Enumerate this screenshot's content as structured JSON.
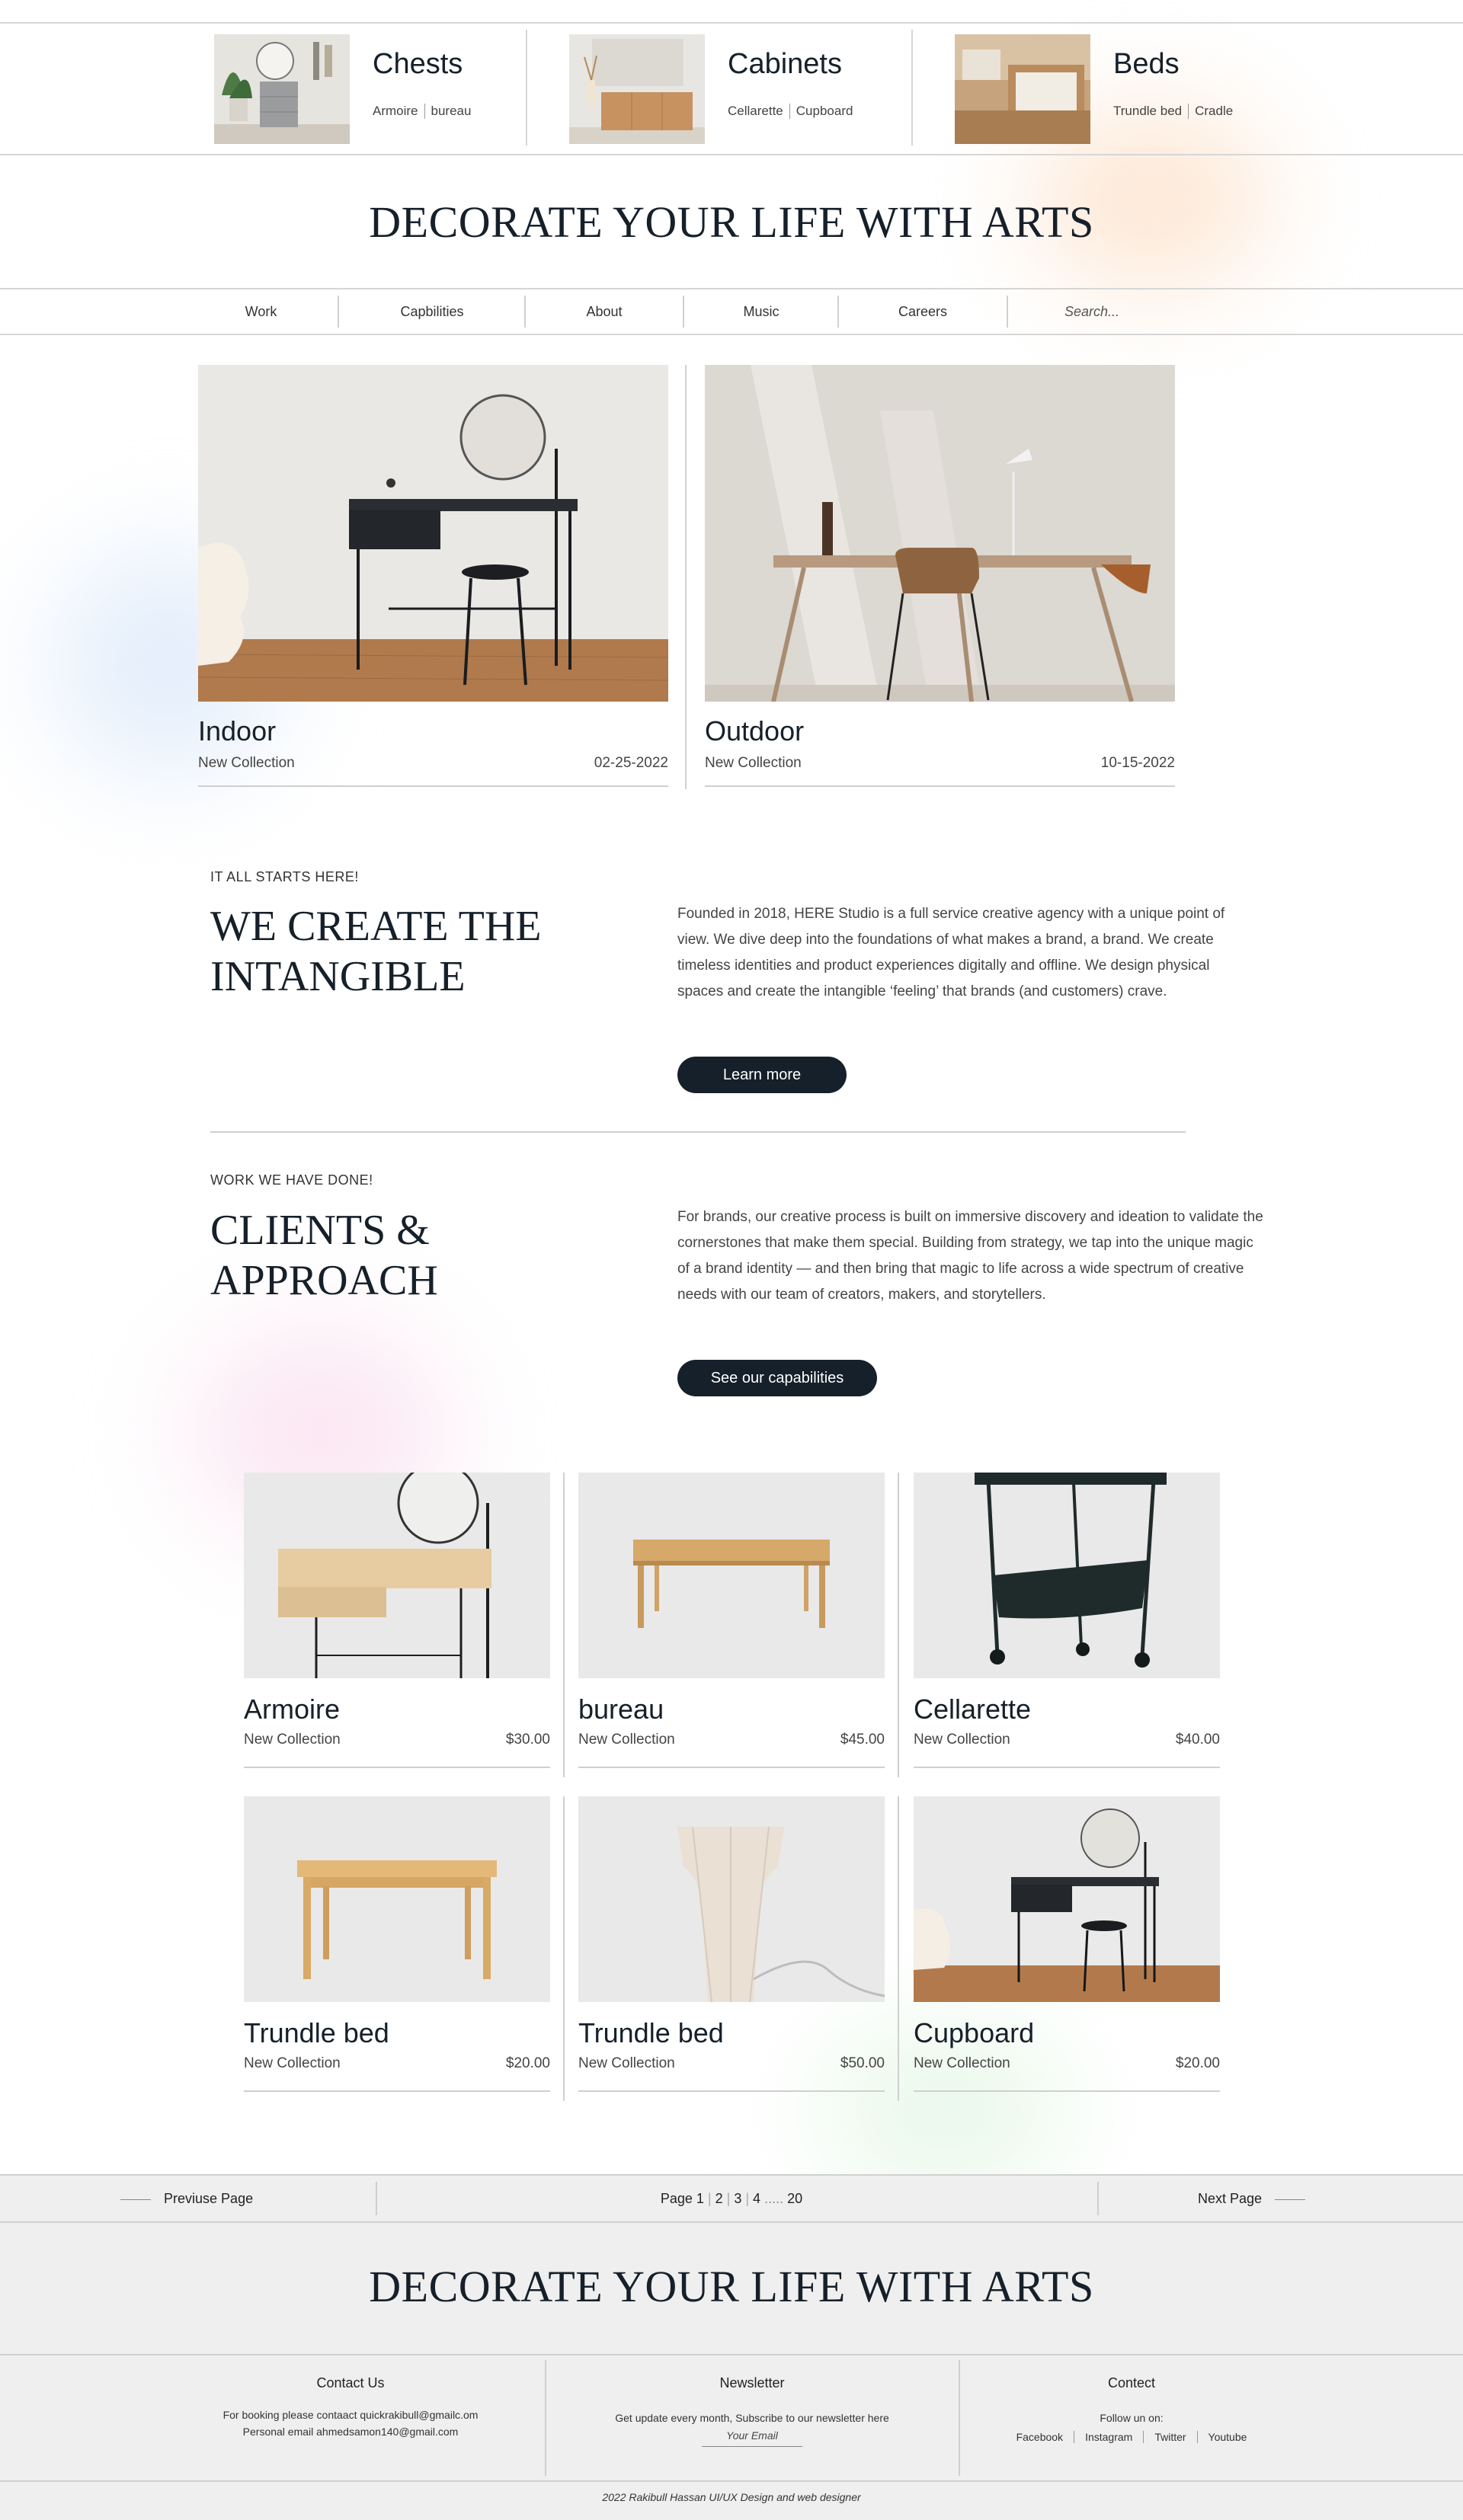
{
  "categories": [
    {
      "title": "Chests",
      "subs": [
        "Armoire",
        "bureau"
      ]
    },
    {
      "title": "Cabinets",
      "subs": [
        "Cellarette",
        "Cupboard"
      ]
    },
    {
      "title": "Beds",
      "subs": [
        "Trundle bed",
        "Cradle"
      ]
    }
  ],
  "headline": "DECORATE YOUR LIFE WITH ARTS",
  "nav": {
    "items": [
      "Work",
      "Capbilities",
      "About",
      "Music",
      "Careers"
    ],
    "search_placeholder": "Search..."
  },
  "featured": [
    {
      "name": "Indoor",
      "tag": "New Collection",
      "date": "02-25-2022"
    },
    {
      "name": "Outdoor",
      "tag": "New Collection",
      "date": "10-15-2022"
    }
  ],
  "about": {
    "eyebrow": "IT ALL STARTS HERE!",
    "title_line1": "WE CREATE THE",
    "title_line2": "INTANGIBLE",
    "text": "Founded in 2018, HERE Studio is a full service creative agency with a unique point of view. We dive deep into the foundations of what makes a brand, a brand. We create timeless identities and product experiences digitally and offline. We design physical spaces and create the intangible ‘feeling’ that brands (and customers) crave.",
    "button": "Learn more"
  },
  "clients": {
    "eyebrow": "WORK WE HAVE DONE!",
    "title_line1": "CLIENTS &",
    "title_line2": "APPROACH",
    "text": "For brands, our creative process is built on immersive discovery and ideation to validate the cornerstones that make them special. Building from strategy, we tap into the unique magic of a brand identity — and then bring that magic to life across a wide spectrum of creative needs with our team of creators, makers, and storytellers.",
    "button": "See our capabilities"
  },
  "products": [
    {
      "name": "Armoire",
      "tag": "New Collection",
      "price": "$30.00"
    },
    {
      "name": "bureau",
      "tag": "New Collection",
      "price": "$45.00"
    },
    {
      "name": "Cellarette",
      "tag": "New Collection",
      "price": "$40.00"
    },
    {
      "name": "Trundle bed",
      "tag": "New Collection",
      "price": "$20.00"
    },
    {
      "name": "Trundle bed",
      "tag": "New Collection",
      "price": "$50.00"
    },
    {
      "name": "Cupboard",
      "tag": "New Collection",
      "price": "$20.00"
    }
  ],
  "pager": {
    "prev": "Previuse Page",
    "next": "Next Page",
    "label": "Page 1",
    "pages": [
      "2",
      "3",
      "4",
      "20"
    ]
  },
  "footer": {
    "headline": "DECORATE YOUR LIFE WITH ARTS",
    "contact_title": "Contact Us",
    "contact_line1": "For booking please contaact quickrakibull@gmailc.om",
    "contact_line2": "Personal email ahmedsamon140@gmail.com",
    "newsletter_title": "Newsletter",
    "newsletter_text": "Get update every month, Subscribe to our newsletter here",
    "email_placeholder": "Your Email",
    "social_title": "Contect",
    "follow": "Follow un on:",
    "socials": [
      "Facebook",
      "Instagram",
      "Twitter",
      "Youtube"
    ],
    "credit": "2022 Rakibull Hassan UI/UX Design and web designer"
  },
  "colors": {
    "accent": "#16202a",
    "divider": "#d6d6d6",
    "footer_bg": "#efefef"
  }
}
